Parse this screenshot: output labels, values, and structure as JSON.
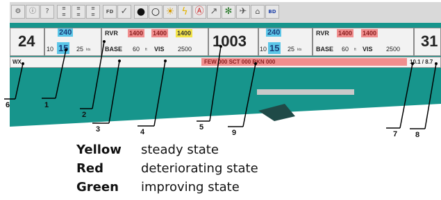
{
  "toolbar": {
    "buttons": [
      {
        "id": "tool-1",
        "text": "",
        "icon": "tool-icon"
      },
      {
        "id": "tool-2",
        "text": "",
        "icon": "info-icon"
      },
      {
        "id": "tool-3",
        "text": "?",
        "icon": "help-icon"
      },
      {
        "id": "fmt-1",
        "text": "",
        "icon": "format-icon"
      },
      {
        "id": "fmt-2",
        "text": "",
        "icon": "format-icon"
      },
      {
        "id": "fmt-3",
        "text": "",
        "icon": "format-icon"
      },
      {
        "id": "fd",
        "text": "FD",
        "icon": "fd-icon"
      },
      {
        "id": "check",
        "text": "✓",
        "icon": "check-icon"
      },
      {
        "id": "c1",
        "text": "",
        "icon": "dark-circle-icon"
      },
      {
        "id": "c2",
        "text": "",
        "icon": "ring-icon"
      },
      {
        "id": "sun",
        "text": "",
        "icon": "sun-icon"
      },
      {
        "id": "bolt",
        "text": "",
        "icon": "lightning-icon"
      },
      {
        "id": "alert",
        "text": "",
        "icon": "alert-icon"
      },
      {
        "id": "arrow",
        "text": "",
        "icon": "diagonal-arrow-icon"
      },
      {
        "id": "gear",
        "text": "",
        "icon": "gear-icon"
      },
      {
        "id": "plane",
        "text": "",
        "icon": "plane-icon"
      },
      {
        "id": "map",
        "text": "",
        "icon": "map-icon"
      },
      {
        "id": "bd",
        "text": "BD",
        "icon": "bd-icon"
      }
    ]
  },
  "panel": {
    "rwy_left": "24",
    "wind1": {
      "dir": "240",
      "min": "10",
      "spd": "15",
      "max": "25",
      "unit": "kts"
    },
    "rvr1": {
      "label": "RVR",
      "values": [
        "1400",
        "1400",
        "1400"
      ]
    },
    "base1": {
      "label": "BASE",
      "value": "60",
      "unit": "ft"
    },
    "vis1": {
      "label": "VIS",
      "value": "2500"
    },
    "qnh": "1003",
    "wind2": {
      "dir": "240",
      "min": "10",
      "spd": "15",
      "max": "25",
      "unit": "kts"
    },
    "rvr2": {
      "label": "RVR",
      "values": [
        "1400",
        "1400"
      ]
    },
    "base2": {
      "label": "BASE",
      "value": "60",
      "unit": "ft"
    },
    "vis2": {
      "label": "VIS",
      "value": "2500"
    },
    "rwy_right": "31"
  },
  "wx": {
    "label": "WX",
    "metar": "FEW 000 SCT 000 BKN 000",
    "temp": "10.1 / 8.7"
  },
  "callouts": [
    "1",
    "2",
    "3",
    "4",
    "5",
    "6",
    "7",
    "8",
    "9"
  ],
  "legend": [
    {
      "key": "Yellow",
      "desc": "steady state"
    },
    {
      "key": "Red",
      "desc": "deteriorating state"
    },
    {
      "key": "Green",
      "desc": "improving state"
    }
  ],
  "colors": {
    "teal": "#17958c",
    "red_hl": "#f08e8e",
    "yellow_hl": "#f3e348",
    "cyan_hl": "#5bc6e8"
  }
}
